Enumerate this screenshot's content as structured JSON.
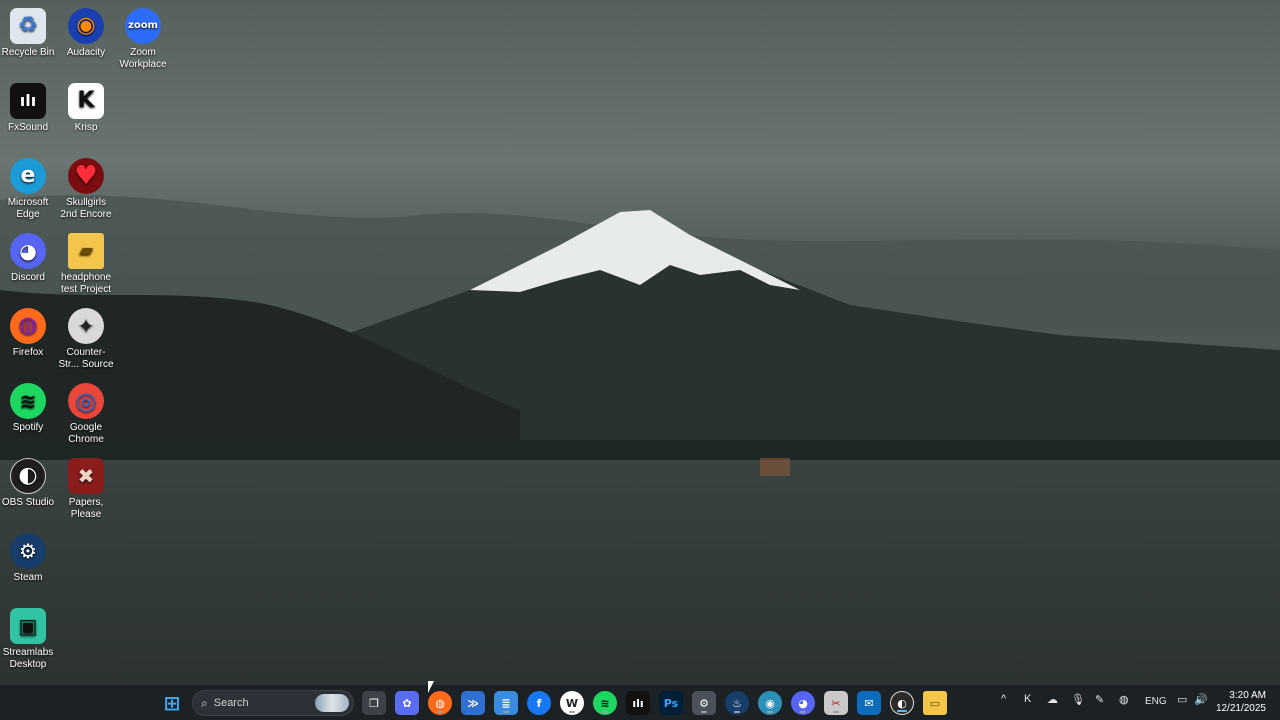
{
  "desktop": {
    "icons": [
      {
        "name": "Recycle Bin",
        "glyph": "♻",
        "bg": "#dfe6ee",
        "fg": "#3b7bd8"
      },
      {
        "name": "Audacity",
        "glyph": "◉",
        "bg": "#1a3fb0",
        "fg": "#ff8a00"
      },
      {
        "name": "Zoom Workplace",
        "glyph": "zoom",
        "bg": "#2d6cf6",
        "fg": "#ffffff"
      },
      {
        "name": "FxSound",
        "glyph": "ılı",
        "bg": "#111111",
        "fg": "#ffffff"
      },
      {
        "name": "Krisp",
        "glyph": "K",
        "bg": "#ffffff",
        "fg": "#111111"
      },
      {
        "name": "Microsoft Edge",
        "glyph": "e",
        "bg": "#1d9bd6",
        "fg": "#ffffff"
      },
      {
        "name": "Skullgirls 2nd Encore",
        "glyph": "♥",
        "bg": "#7a0d12",
        "fg": "#ff2c3a"
      },
      {
        "name": "Discord",
        "glyph": "◕",
        "bg": "#5865f2",
        "fg": "#ffffff"
      },
      {
        "name": "headphone test Project",
        "glyph": "▰",
        "bg": "#f3c54a",
        "fg": "#6b4b00"
      },
      {
        "name": "Firefox",
        "glyph": "◍",
        "bg": "#ff6b1a",
        "fg": "#7d1fd2"
      },
      {
        "name": "Counter-Str... Source",
        "glyph": "✦",
        "bg": "#d9d9d9",
        "fg": "#222222"
      },
      {
        "name": "Spotify",
        "glyph": "≋",
        "bg": "#1ed760",
        "fg": "#111111"
      },
      {
        "name": "Google Chrome",
        "glyph": "◎",
        "bg": "#e9473b",
        "fg": "#1a73e8"
      },
      {
        "name": "OBS Studio",
        "glyph": "◐",
        "bg": "#1e1e1e",
        "fg": "#ffffff"
      },
      {
        "name": "Papers, Please",
        "glyph": "✖",
        "bg": "#8a1c1c",
        "fg": "#f1d3c2"
      },
      {
        "name": "Steam",
        "glyph": "⚙",
        "bg": "#173d6a",
        "fg": "#ffffff"
      },
      {
        "name": "Streamlabs Desktop",
        "glyph": "▣",
        "bg": "#31c3a2",
        "fg": "#111111"
      }
    ]
  },
  "taskbar": {
    "start_glyph": "⊞",
    "search_label": "Search",
    "apps": [
      {
        "name": "task-view",
        "glyph": "❐",
        "bg": "#3c4247"
      },
      {
        "name": "copilot",
        "glyph": "✿",
        "bg": "#5a6cf0"
      },
      {
        "name": "firefox",
        "glyph": "◍",
        "bg": "#ff6b1a"
      },
      {
        "name": "vscode",
        "glyph": "≫",
        "bg": "#2f6fd0"
      },
      {
        "name": "notepad",
        "glyph": "≣",
        "bg": "#3a8dde"
      },
      {
        "name": "facebook",
        "glyph": "f",
        "bg": "#1877f2"
      },
      {
        "name": "wordpad",
        "glyph": "W",
        "bg": "#ffffff"
      },
      {
        "name": "spotify",
        "glyph": "≋",
        "bg": "#1ed760"
      },
      {
        "name": "fxsound",
        "glyph": "ılı",
        "bg": "#111111"
      },
      {
        "name": "photoshop",
        "glyph": "Ps",
        "bg": "#001e36"
      },
      {
        "name": "settings",
        "glyph": "⚙",
        "bg": "#4a5158"
      },
      {
        "name": "steam",
        "glyph": "♨",
        "bg": "#173d6a"
      },
      {
        "name": "globe",
        "glyph": "◉",
        "bg": "#2d8fb8"
      },
      {
        "name": "discord",
        "glyph": "◕",
        "bg": "#5865f2"
      },
      {
        "name": "snip",
        "glyph": "✂",
        "bg": "#c9c9c9"
      },
      {
        "name": "outlook",
        "glyph": "✉",
        "bg": "#0f6cbd"
      },
      {
        "name": "obs",
        "glyph": "◐",
        "bg": "#2a2a2a"
      },
      {
        "name": "file-explorer",
        "glyph": "▭",
        "bg": "#f3c54a"
      }
    ],
    "tray": {
      "chevron": "^",
      "icons": [
        "K",
        "☁",
        "🎙",
        "✎",
        "◍"
      ],
      "lang": "ENG",
      "display_icon": "▭",
      "volume_icon": "🔊",
      "time": "3:20 AM",
      "date": "12/21/2025"
    }
  }
}
